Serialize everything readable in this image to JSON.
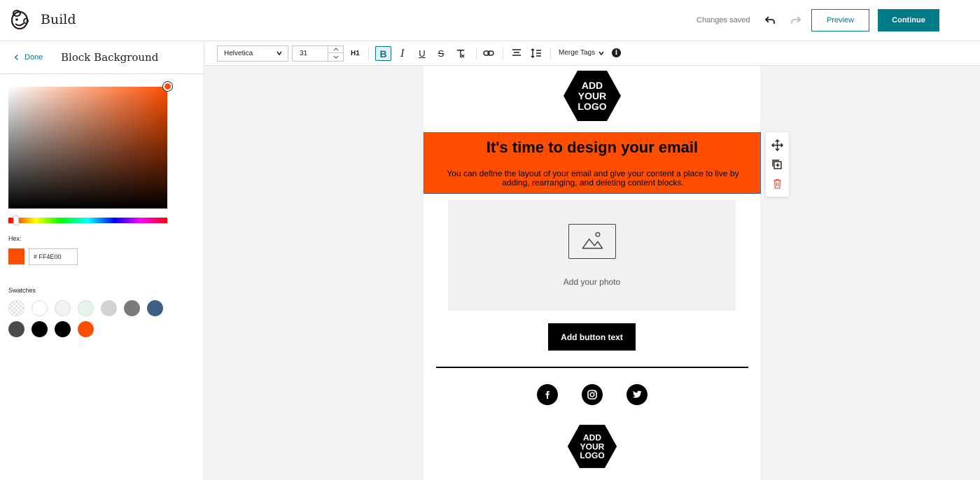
{
  "header": {
    "app_title": "Build",
    "status": "Changes saved",
    "preview_label": "Preview",
    "continue_label": "Continue"
  },
  "sidebar": {
    "done_label": "Done",
    "panel_title": "Block Background",
    "hex_label": "Hex:",
    "hex_value": "# FF4E00",
    "swatches_label": "Swatches",
    "selected_color": "#FF4E00",
    "swatches": [
      "transparent",
      "#ffffff",
      "#f2f2f2",
      "#e5f3ea",
      "#d2d2d2",
      "#7a7a7a",
      "#3e5f85",
      "#4a4a4a",
      "#000000",
      "#000000",
      "#ff4e00"
    ]
  },
  "toolbar": {
    "font": "Helvetica",
    "font_size": "31",
    "h1_label": "H1",
    "bold_label": "B",
    "italic_label": "I",
    "underline_label": "U",
    "strike_label": "S",
    "clear_label": "T",
    "merge_tags_label": "Merge Tags",
    "info_label": "i"
  },
  "email": {
    "logo_text": "ADD YOUR LOGO",
    "logo_lines": [
      "ADD",
      "YOUR",
      "LOGO"
    ],
    "heading": "It's time to design your email",
    "body": "You can define the layout of your email and give your content a place to live by adding, rearranging, and deleting content blocks.",
    "photo_label": "Add your photo",
    "button_label": "Add button text",
    "social": [
      "facebook-icon",
      "instagram-icon",
      "twitter-icon"
    ],
    "block_color": "#FF4E00"
  }
}
